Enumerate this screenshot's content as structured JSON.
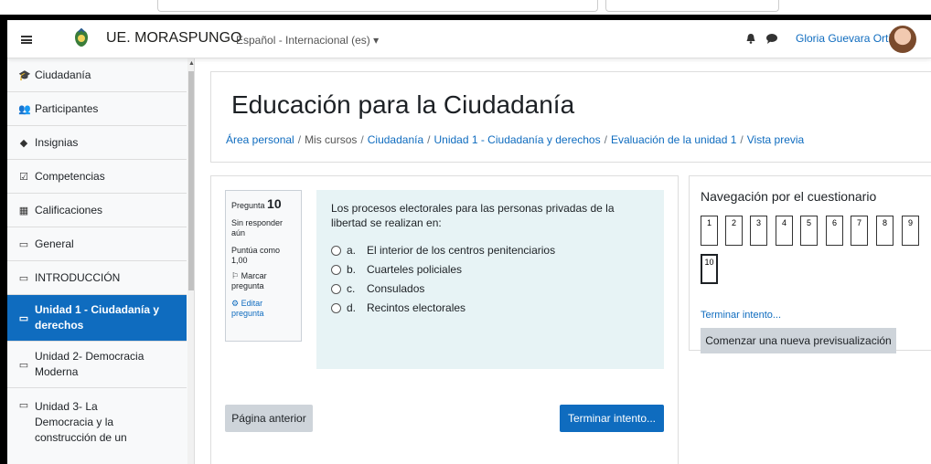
{
  "navbar": {
    "menu_icon": "hamburger-icon",
    "site_name": "UE. MORASPUNGO",
    "language": "Español - Internacional (es) ▾",
    "user_name": "Gloria Guevara Ortiz"
  },
  "sidebar": {
    "items": [
      {
        "label": "Ciudadanía",
        "icon": "graduation-cap-icon",
        "glyph": "🎓"
      },
      {
        "label": "Participantes",
        "icon": "users-icon",
        "glyph": "👥"
      },
      {
        "label": "Insignias",
        "icon": "shield-icon",
        "glyph": "◆"
      },
      {
        "label": "Competencias",
        "icon": "checkbox-icon",
        "glyph": "☑"
      },
      {
        "label": "Calificaciones",
        "icon": "table-icon",
        "glyph": "▦"
      },
      {
        "label": "General",
        "icon": "folder-icon",
        "glyph": "▭"
      },
      {
        "label": "INTRODUCCIÓN",
        "icon": "folder-icon",
        "glyph": "▭"
      },
      {
        "label": "Unidad 1 - Ciudadanía y derechos",
        "icon": "folder-icon",
        "glyph": "▭"
      },
      {
        "label": "Unidad 2- Democracia Moderna",
        "icon": "folder-icon",
        "glyph": "▭"
      },
      {
        "label": "Unidad 3- La Democracia y la construcción de un",
        "icon": "folder-icon",
        "glyph": "▭"
      }
    ]
  },
  "page": {
    "title": "Educación para la Ciudadanía",
    "breadcrumb": [
      "Área personal",
      "Mis cursos",
      "Ciudadanía",
      "Unidad 1 - Ciudadanía y derechos",
      "Evaluación de la unidad 1",
      "Vista previa"
    ]
  },
  "question": {
    "label": "Pregunta",
    "number": "10",
    "status": "Sin responder aún",
    "score": "Puntúa como 1,00",
    "flag": "Marcar pregunta",
    "edit": "Editar pregunta",
    "prompt": "Los procesos electorales para las personas privadas de la libertad se realizan en:",
    "options": [
      {
        "letter": "a.",
        "text": "El interior de los centros penitenciarios"
      },
      {
        "letter": "b.",
        "text": "Cuarteles policiales"
      },
      {
        "letter": "c.",
        "text": "Consulados"
      },
      {
        "letter": "d.",
        "text": "Recintos electorales"
      }
    ],
    "prev_button": "Página anterior",
    "finish_button": "Terminar intento..."
  },
  "quiz_nav": {
    "title": "Navegación por el cuestionario",
    "buttons": [
      "1",
      "2",
      "3",
      "4",
      "5",
      "6",
      "7",
      "8",
      "9",
      "10"
    ],
    "current": "10",
    "finish_link": "Terminar intento...",
    "new_preview": "Comenzar una nueva previsualización"
  }
}
